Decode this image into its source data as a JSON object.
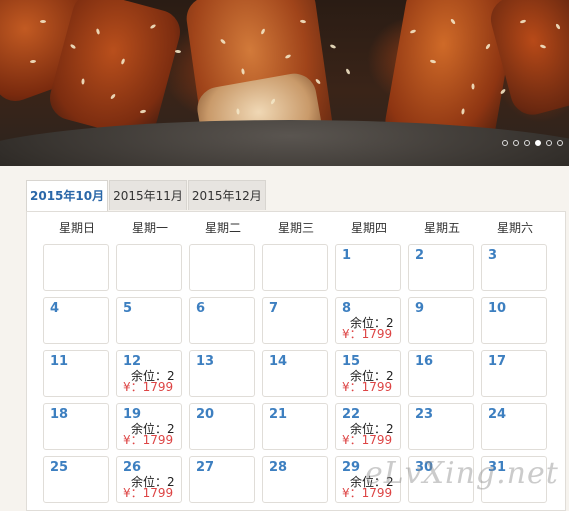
{
  "hero": {
    "slides": [
      {},
      {},
      {},
      {},
      {},
      {}
    ],
    "active_slide": 3
  },
  "calendar": {
    "tabs": [
      {
        "label": "2015年10月",
        "active": true
      },
      {
        "label": "2015年11月",
        "active": false
      },
      {
        "label": "2015年12月",
        "active": false
      }
    ],
    "weekdays": [
      "星期日",
      "星期一",
      "星期二",
      "星期三",
      "星期四",
      "星期五",
      "星期六"
    ],
    "weeks": [
      [
        {
          "day": ""
        },
        {
          "day": ""
        },
        {
          "day": ""
        },
        {
          "day": ""
        },
        {
          "day": "1"
        },
        {
          "day": "2"
        },
        {
          "day": "3"
        }
      ],
      [
        {
          "day": "4"
        },
        {
          "day": "5"
        },
        {
          "day": "6"
        },
        {
          "day": "7"
        },
        {
          "day": "8",
          "seats": "余位：2",
          "price": "¥：1799"
        },
        {
          "day": "9"
        },
        {
          "day": "10"
        }
      ],
      [
        {
          "day": "11"
        },
        {
          "day": "12",
          "seats": "余位：2",
          "price": "¥：1799"
        },
        {
          "day": "13"
        },
        {
          "day": "14"
        },
        {
          "day": "15",
          "seats": "余位：2",
          "price": "¥：1799"
        },
        {
          "day": "16"
        },
        {
          "day": "17"
        }
      ],
      [
        {
          "day": "18"
        },
        {
          "day": "19",
          "seats": "余位：2",
          "price": "¥：1799"
        },
        {
          "day": "20"
        },
        {
          "day": "21"
        },
        {
          "day": "22",
          "seats": "余位：2",
          "price": "¥：1799"
        },
        {
          "day": "23"
        },
        {
          "day": "24"
        }
      ],
      [
        {
          "day": "25"
        },
        {
          "day": "26",
          "seats": "余位：2",
          "price": "¥：1799"
        },
        {
          "day": "27"
        },
        {
          "day": "28"
        },
        {
          "day": "29",
          "seats": "余位：2",
          "price": "¥：1799"
        },
        {
          "day": "30"
        },
        {
          "day": "31"
        }
      ]
    ]
  },
  "watermark": "eLvXing.net",
  "colors": {
    "day": "#3d7fc0",
    "price": "#dd4444",
    "active_tab": "#2a67a8"
  }
}
